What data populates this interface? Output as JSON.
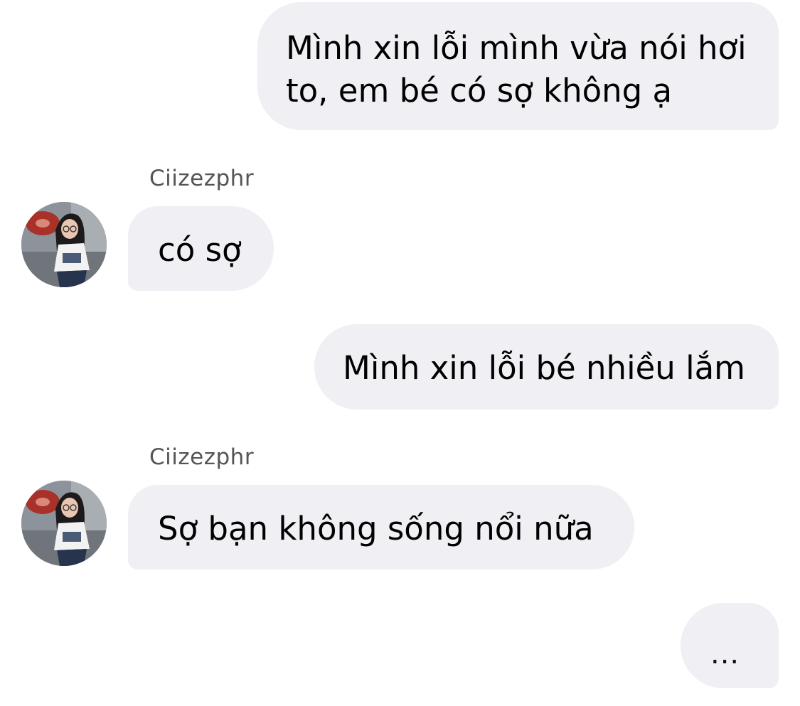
{
  "conversation": {
    "messages": [
      {
        "direction": "outgoing",
        "text": "Mình xin lỗi mình vừa nói hơi to, em bé có sợ không ạ"
      },
      {
        "direction": "incoming",
        "sender": "Ciizezphr",
        "text": "có sợ"
      },
      {
        "direction": "outgoing",
        "text": "Mình xin lỗi bé nhiều lắm"
      },
      {
        "direction": "incoming",
        "sender": "Ciizezphr",
        "text": "Sợ bạn không sống nổi nữa"
      },
      {
        "direction": "outgoing",
        "text": "..."
      }
    ]
  },
  "avatar_icon": "profile-photo-icon",
  "colors": {
    "bubble_background": "#efeff4",
    "text": "#000000",
    "sender_name": "#555555",
    "background": "#ffffff"
  }
}
